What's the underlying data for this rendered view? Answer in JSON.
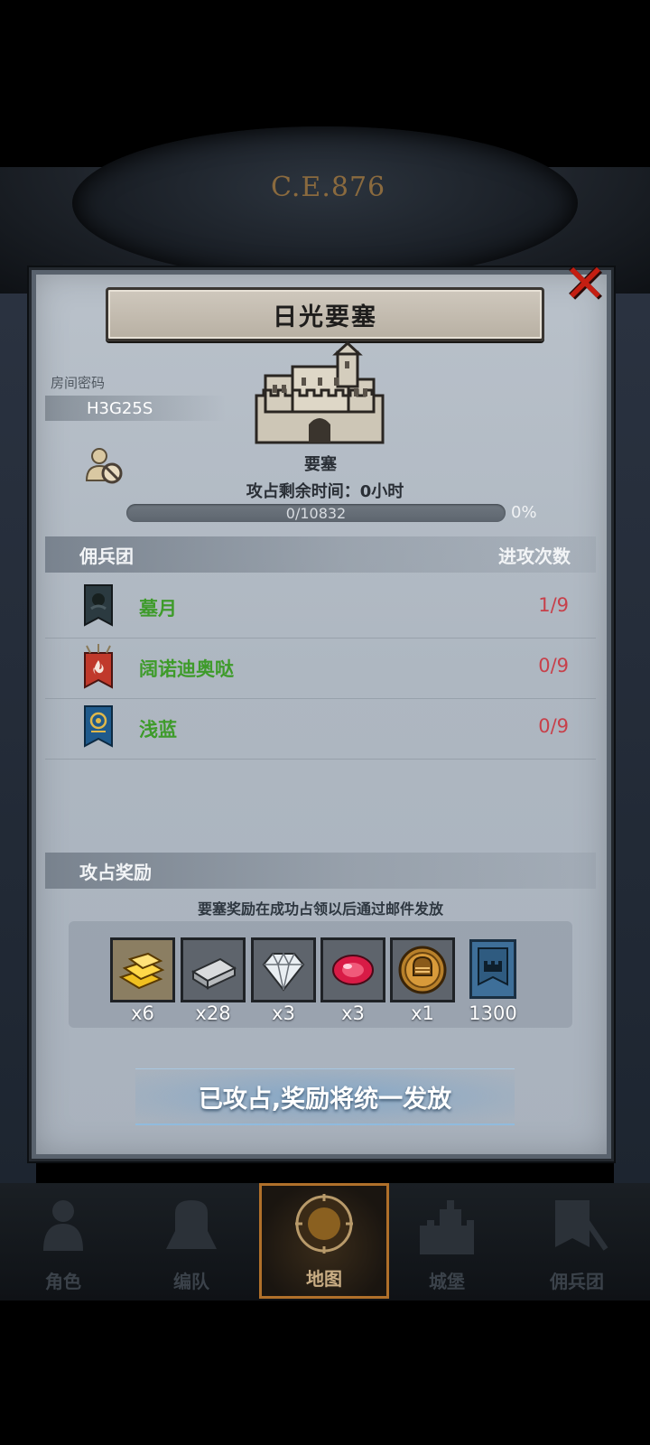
{
  "background": {
    "era_label": "C.E.876"
  },
  "dialog": {
    "title": "日光要塞",
    "close_icon": "close-x-icon",
    "room_label": "房间密码",
    "room_code": "H3G25S",
    "castle_label": "要塞",
    "time_remaining": "攻占剩余时间：0小时",
    "progress_text": "0/10832",
    "progress_percent": "0%",
    "progress_fraction": 0,
    "mercenary_header": "佣兵团",
    "attack_count_header": "进攻次数",
    "mercenaries": [
      {
        "name": "墓月",
        "count": "1/9",
        "flag_color": "#2b3a40",
        "flag_icon": "moon-banner-icon"
      },
      {
        "name": "阔诺迪奥哒",
        "count": "0/9",
        "flag_color": "#c0392b",
        "flag_icon": "flame-banner-icon"
      },
      {
        "name": "浅蓝",
        "count": "0/9",
        "flag_color": "#1f5a8c",
        "flag_icon": "sun-eye-banner-icon"
      }
    ],
    "reward_header": "攻占奖励",
    "reward_note": "要塞奖励在成功占领以后通过邮件发放",
    "rewards": [
      {
        "icon": "gold-bars-icon",
        "qty": "x6"
      },
      {
        "icon": "iron-ingot-icon",
        "qty": "x28"
      },
      {
        "icon": "diamond-icon",
        "qty": "x3"
      },
      {
        "icon": "ruby-icon",
        "qty": "x3"
      },
      {
        "icon": "knight-helmet-coin-icon",
        "qty": "x1"
      },
      {
        "icon": "castle-banner-icon",
        "qty": "1300"
      }
    ],
    "claim_button": "已攻占,奖励将统一发放"
  },
  "nav": [
    {
      "label": "角色",
      "icon": "character-icon",
      "active": false
    },
    {
      "label": "编队",
      "icon": "formation-icon",
      "active": false
    },
    {
      "label": "地图",
      "icon": "map-compass-icon",
      "active": true
    },
    {
      "label": "城堡",
      "icon": "castle-icon",
      "active": false
    },
    {
      "label": "佣兵团",
      "icon": "mercenary-icon",
      "active": false
    }
  ],
  "colors": {
    "accent_green": "#3e9b2a",
    "count_red": "#c7404a",
    "close_red": "#c41e12",
    "nav_active_border": "#b0702a"
  }
}
